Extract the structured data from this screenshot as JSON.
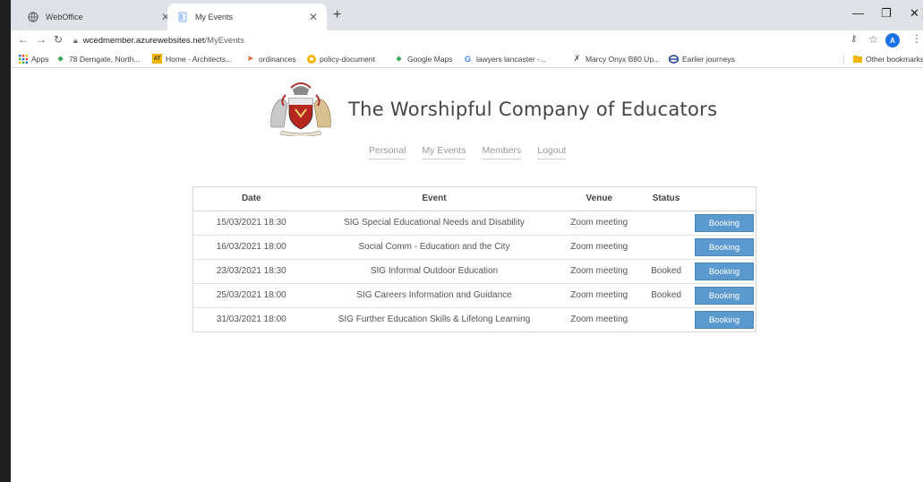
{
  "browser": {
    "tabs": [
      {
        "title": "WebOffice",
        "active": false
      },
      {
        "title": "My Events",
        "active": true
      }
    ],
    "url_host": "wcedmember.azurewebsites.net",
    "url_path": "/MyEvents",
    "profile_initial": "A",
    "bookmarks": [
      "Apps",
      "78 Derngate, North...",
      "Home - Architects...",
      "ordinances",
      "policy-document",
      "Google Maps",
      "lawyers lancaster -...",
      "Marcy Onyx B80 Up...",
      "Earlier journeys"
    ],
    "other_bookmarks": "Other bookmarks"
  },
  "site": {
    "title": "The Worshipful Company of Educators",
    "nav": [
      "Personal",
      "My Events",
      "Members",
      "Logout"
    ]
  },
  "events_table": {
    "headers": [
      "Date",
      "Event",
      "Venue",
      "Status"
    ],
    "rows": [
      {
        "date": "15/03/2021 18:30",
        "event": "SIG Special Educational Needs and Disability",
        "venue": "Zoom meeting",
        "status": "",
        "action": "Booking"
      },
      {
        "date": "16/03/2021 18:00",
        "event": "Social Comm - Education and the City",
        "venue": "Zoom meeting",
        "status": "",
        "action": "Booking"
      },
      {
        "date": "23/03/2021 18:30",
        "event": "SIG Informal Outdoor Education",
        "venue": "Zoom meeting",
        "status": "Booked",
        "action": "Booking"
      },
      {
        "date": "25/03/2021 18:00",
        "event": "SIG Careers Information and Guidance",
        "venue": "Zoom meeting",
        "status": "Booked",
        "action": "Booking"
      },
      {
        "date": "31/03/2021 18:00",
        "event": "SIG Further Education Skills & Lifelong Learning",
        "venue": "Zoom meeting",
        "status": "",
        "action": "Booking"
      }
    ]
  },
  "colors": {
    "booking_button": "#5a9acf",
    "tab_strip": "#dee1e6",
    "profile": "#1a73e8"
  }
}
